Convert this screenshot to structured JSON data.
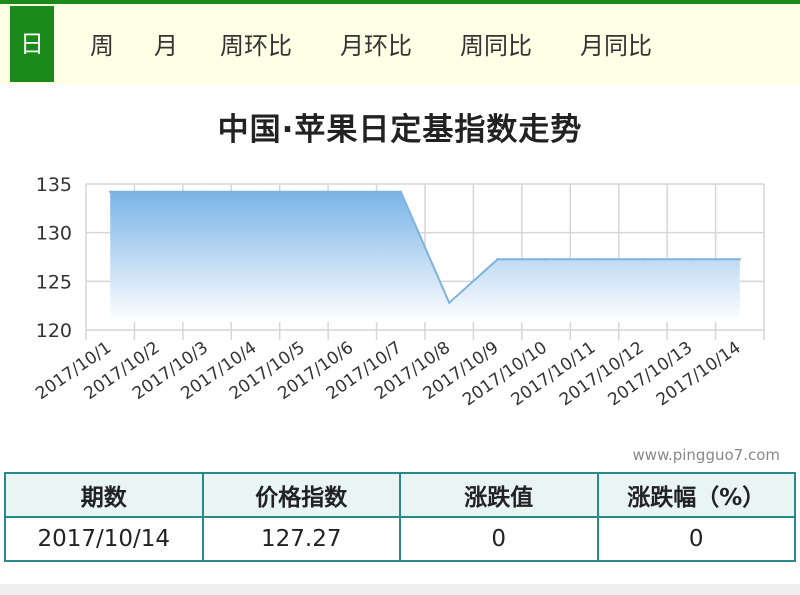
{
  "tabs": [
    {
      "label": "日",
      "active": true
    },
    {
      "label": "周",
      "active": false
    },
    {
      "label": "月",
      "active": false
    },
    {
      "label": "周环比",
      "active": false
    },
    {
      "label": "月环比",
      "active": false
    },
    {
      "label": "周同比",
      "active": false
    },
    {
      "label": "月同比",
      "active": false
    }
  ],
  "chart_data": {
    "type": "area",
    "title": "中国·苹果日定基指数走势",
    "xlabel": "",
    "ylabel": "",
    "categories": [
      "2017/10/1",
      "2017/10/2",
      "2017/10/3",
      "2017/10/4",
      "2017/10/5",
      "2017/10/6",
      "2017/10/7",
      "2017/10/8",
      "2017/10/9",
      "2017/10/10",
      "2017/10/11",
      "2017/10/12",
      "2017/10/13",
      "2017/10/14"
    ],
    "series": [
      {
        "values": [
          134.2,
          134.2,
          134.2,
          134.2,
          134.2,
          134.2,
          134.2,
          122.8,
          127.27,
          127.27,
          127.27,
          127.27,
          127.27,
          127.27
        ]
      }
    ],
    "ylim": [
      120,
      135
    ],
    "yticks": [
      "120",
      "125",
      "130",
      "135"
    ],
    "grid": true,
    "colors": {
      "fill_top": "#7ab3e6",
      "fill_bottom": "#ffffff",
      "line": "#7fb2de",
      "grid": "#d6d6d6"
    }
  },
  "watermark": "www.pingguo7.com",
  "summary": {
    "headers": [
      "期数",
      "价格指数",
      "涨跌值",
      "涨跌幅（%）"
    ],
    "row": [
      "2017/10/14",
      "127.27",
      "0",
      "0"
    ]
  },
  "colors": {
    "brand_green": "#1a8a1a",
    "tab_bg": "#ffffe6",
    "table_border": "#2a8a8a"
  }
}
